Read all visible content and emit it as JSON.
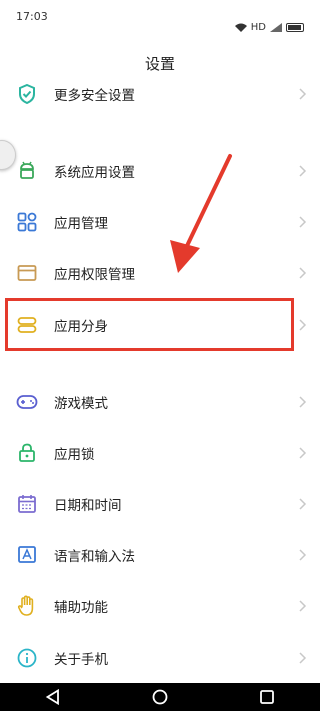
{
  "status_bar": {
    "time": "17:03",
    "network": "HD"
  },
  "header": {
    "title": "设置"
  },
  "settings": {
    "more_security": "更多安全设置",
    "system_apps": "系统应用设置",
    "app_management": "应用管理",
    "app_permissions": "应用权限管理",
    "app_clone": "应用分身",
    "game_mode": "游戏模式",
    "app_lock": "应用锁",
    "date_time": "日期和时间",
    "language_input": "语言和输入法",
    "accessibility": "辅助功能",
    "about_phone": "关于手机"
  },
  "colors": {
    "annotation_red": "#e43a2c",
    "accent_teal": "#2bb5a0"
  },
  "icons": {
    "more_security": "shield-check-icon",
    "system_apps": "android-icon",
    "app_management": "apps-grid-icon",
    "app_permissions": "window-icon",
    "app_clone": "stacked-bars-icon",
    "game_mode": "gamepad-icon",
    "app_lock": "lock-icon",
    "date_time": "calendar-icon",
    "language_input": "language-icon",
    "accessibility": "hand-icon",
    "about_phone": "info-icon"
  }
}
